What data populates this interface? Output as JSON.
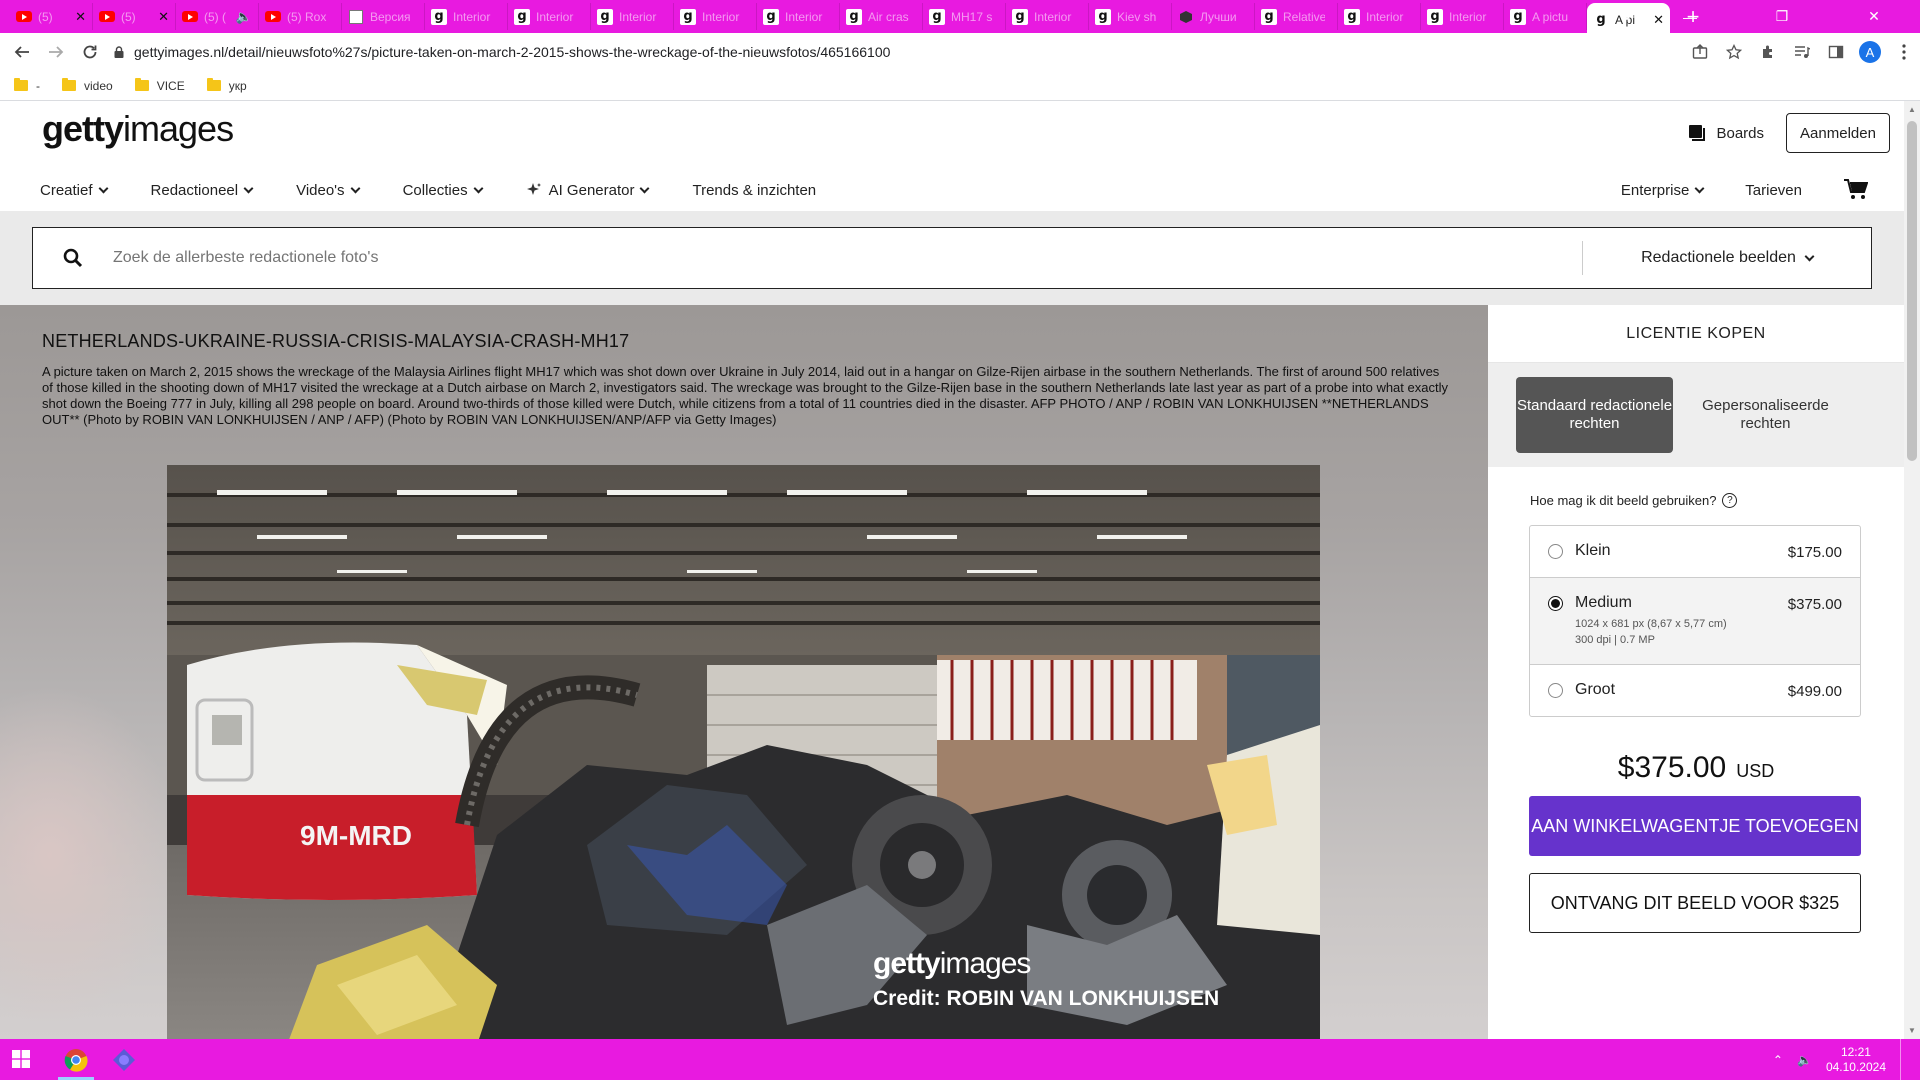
{
  "browser": {
    "tabs": [
      {
        "icon": "youtube-icon",
        "title": "(5)",
        "close": "✕"
      },
      {
        "icon": "youtube-icon",
        "title": "(5)",
        "close": "✕"
      },
      {
        "icon": "youtube-icon",
        "title": "(5) (",
        "close": "🔈"
      },
      {
        "icon": "youtube-icon",
        "title": "(5) Rox",
        "close": ""
      },
      {
        "icon": "doc-icon",
        "title": "Версия",
        "close": ""
      },
      {
        "icon": "getty-icon",
        "title": "Interior",
        "close": ""
      },
      {
        "icon": "getty-icon",
        "title": "Interior",
        "close": ""
      },
      {
        "icon": "getty-icon",
        "title": "Interior",
        "close": ""
      },
      {
        "icon": "getty-icon",
        "title": "Interior",
        "close": ""
      },
      {
        "icon": "getty-icon",
        "title": "Interior",
        "close": ""
      },
      {
        "icon": "getty-icon",
        "title": "Air cras",
        "close": ""
      },
      {
        "icon": "getty-icon",
        "title": "MH17 s",
        "close": ""
      },
      {
        "icon": "getty-icon",
        "title": "Interior",
        "close": ""
      },
      {
        "icon": "getty-icon",
        "title": "Kiev sh",
        "close": ""
      },
      {
        "icon": "cube-icon",
        "title": "Лучши",
        "close": ""
      },
      {
        "icon": "getty-icon",
        "title": "Relative",
        "close": ""
      },
      {
        "icon": "getty-icon",
        "title": "Interior",
        "close": ""
      },
      {
        "icon": "getty-icon",
        "title": "Interior",
        "close": ""
      },
      {
        "icon": "getty-icon",
        "title": "A pictu",
        "close": ""
      }
    ],
    "active_tab": {
      "icon": "getty-icon",
      "title": "A pi",
      "close": "✕"
    },
    "new_tab": "+",
    "url": "gettyimages.nl/detail/nieuwsfoto%27s/picture-taken-on-march-2-2015-shows-the-wreckage-of-the-nieuwsfotos/465166100",
    "profile_initial": "A",
    "bookmarks": [
      {
        "label": "-"
      },
      {
        "label": "video"
      },
      {
        "label": "VICE"
      },
      {
        "label": "укр"
      }
    ]
  },
  "site": {
    "logo_bold": "getty",
    "logo_light": "images",
    "boards": "Boards",
    "signin": "Aanmelden",
    "nav": [
      {
        "label": "Creatief",
        "dropdown": true
      },
      {
        "label": "Redactioneel",
        "dropdown": true
      },
      {
        "label": "Video's",
        "dropdown": true
      },
      {
        "label": "Collecties",
        "dropdown": true
      },
      {
        "label": "AI Generator",
        "dropdown": true
      },
      {
        "label": "Trends & inzichten",
        "dropdown": false
      }
    ],
    "nav_right": {
      "enterprise": "Enterprise",
      "pricing": "Tarieven"
    },
    "search": {
      "placeholder": "Zoek de allerbeste redactionele foto's",
      "filter": "Redactionele beelden"
    }
  },
  "detail": {
    "title": "NETHERLANDS-UKRAINE-RUSSIA-CRISIS-MALAYSIA-CRASH-MH17",
    "caption": "A picture taken on March 2, 2015 shows the wreckage of the Malaysia Airlines flight MH17 which was shot down over Ukraine in July 2014, laid out in a hangar on Gilze-Rijen airbase in the southern Netherlands. The first of around 500 relatives of those killed in the shooting down of MH17 visited the wreckage at a Dutch airbase on March 2, investigators said. The wreckage was brought to the Gilze-Rijen base in the southern Netherlands late last year as part of a probe into what exactly shot down the Boeing 777 in July, killing all 298 people on board. Around two-thirds of those killed were Dutch, while citizens from a total of 11 countries died in the disaster. AFP PHOTO / ANP / ROBIN VAN LONKHUIJSEN **NETHERLANDS OUT** (Photo by ROBIN VAN LONKHUIJSEN / ANP / AFP) (Photo by ROBIN VAN LONKHUIJSEN/ANP/AFP via Getty Images)",
    "photo_registration": "9M-MRD",
    "watermark_bold": "getty",
    "watermark_light": "images",
    "credit": "Credit: ROBIN VAN LONKHUIJSEN"
  },
  "license": {
    "heading": "LICENTIE KOPEN",
    "rights_standard": "Standaard redactionele rechten",
    "rights_custom": "Gepersonaliseerde rechten",
    "how_use": "Hoe mag ik dit beeld gebruiken?",
    "sizes": [
      {
        "name": "Klein",
        "price": "$175.00",
        "details": [],
        "selected": false
      },
      {
        "name": "Medium",
        "price": "$375.00",
        "details": [
          "1024 x 681 px (8,67 x 5,77 cm)",
          "300 dpi | 0.7 MP"
        ],
        "selected": true
      },
      {
        "name": "Groot",
        "price": "$499.00",
        "details": [],
        "selected": false
      }
    ],
    "total": "$375.00",
    "currency": "USD",
    "add_to_cart": "AAN WINKELWAGENTJE TOEVOEGEN",
    "get_image": "ONTVANG DIT BEELD VOOR $325"
  },
  "taskbar": {
    "time": "12:21",
    "date": "04.10.2024"
  },
  "colors": {
    "chrome_frame": "#e81ae0",
    "cta_purple": "#6633cc",
    "selected_rights": "#555555"
  }
}
